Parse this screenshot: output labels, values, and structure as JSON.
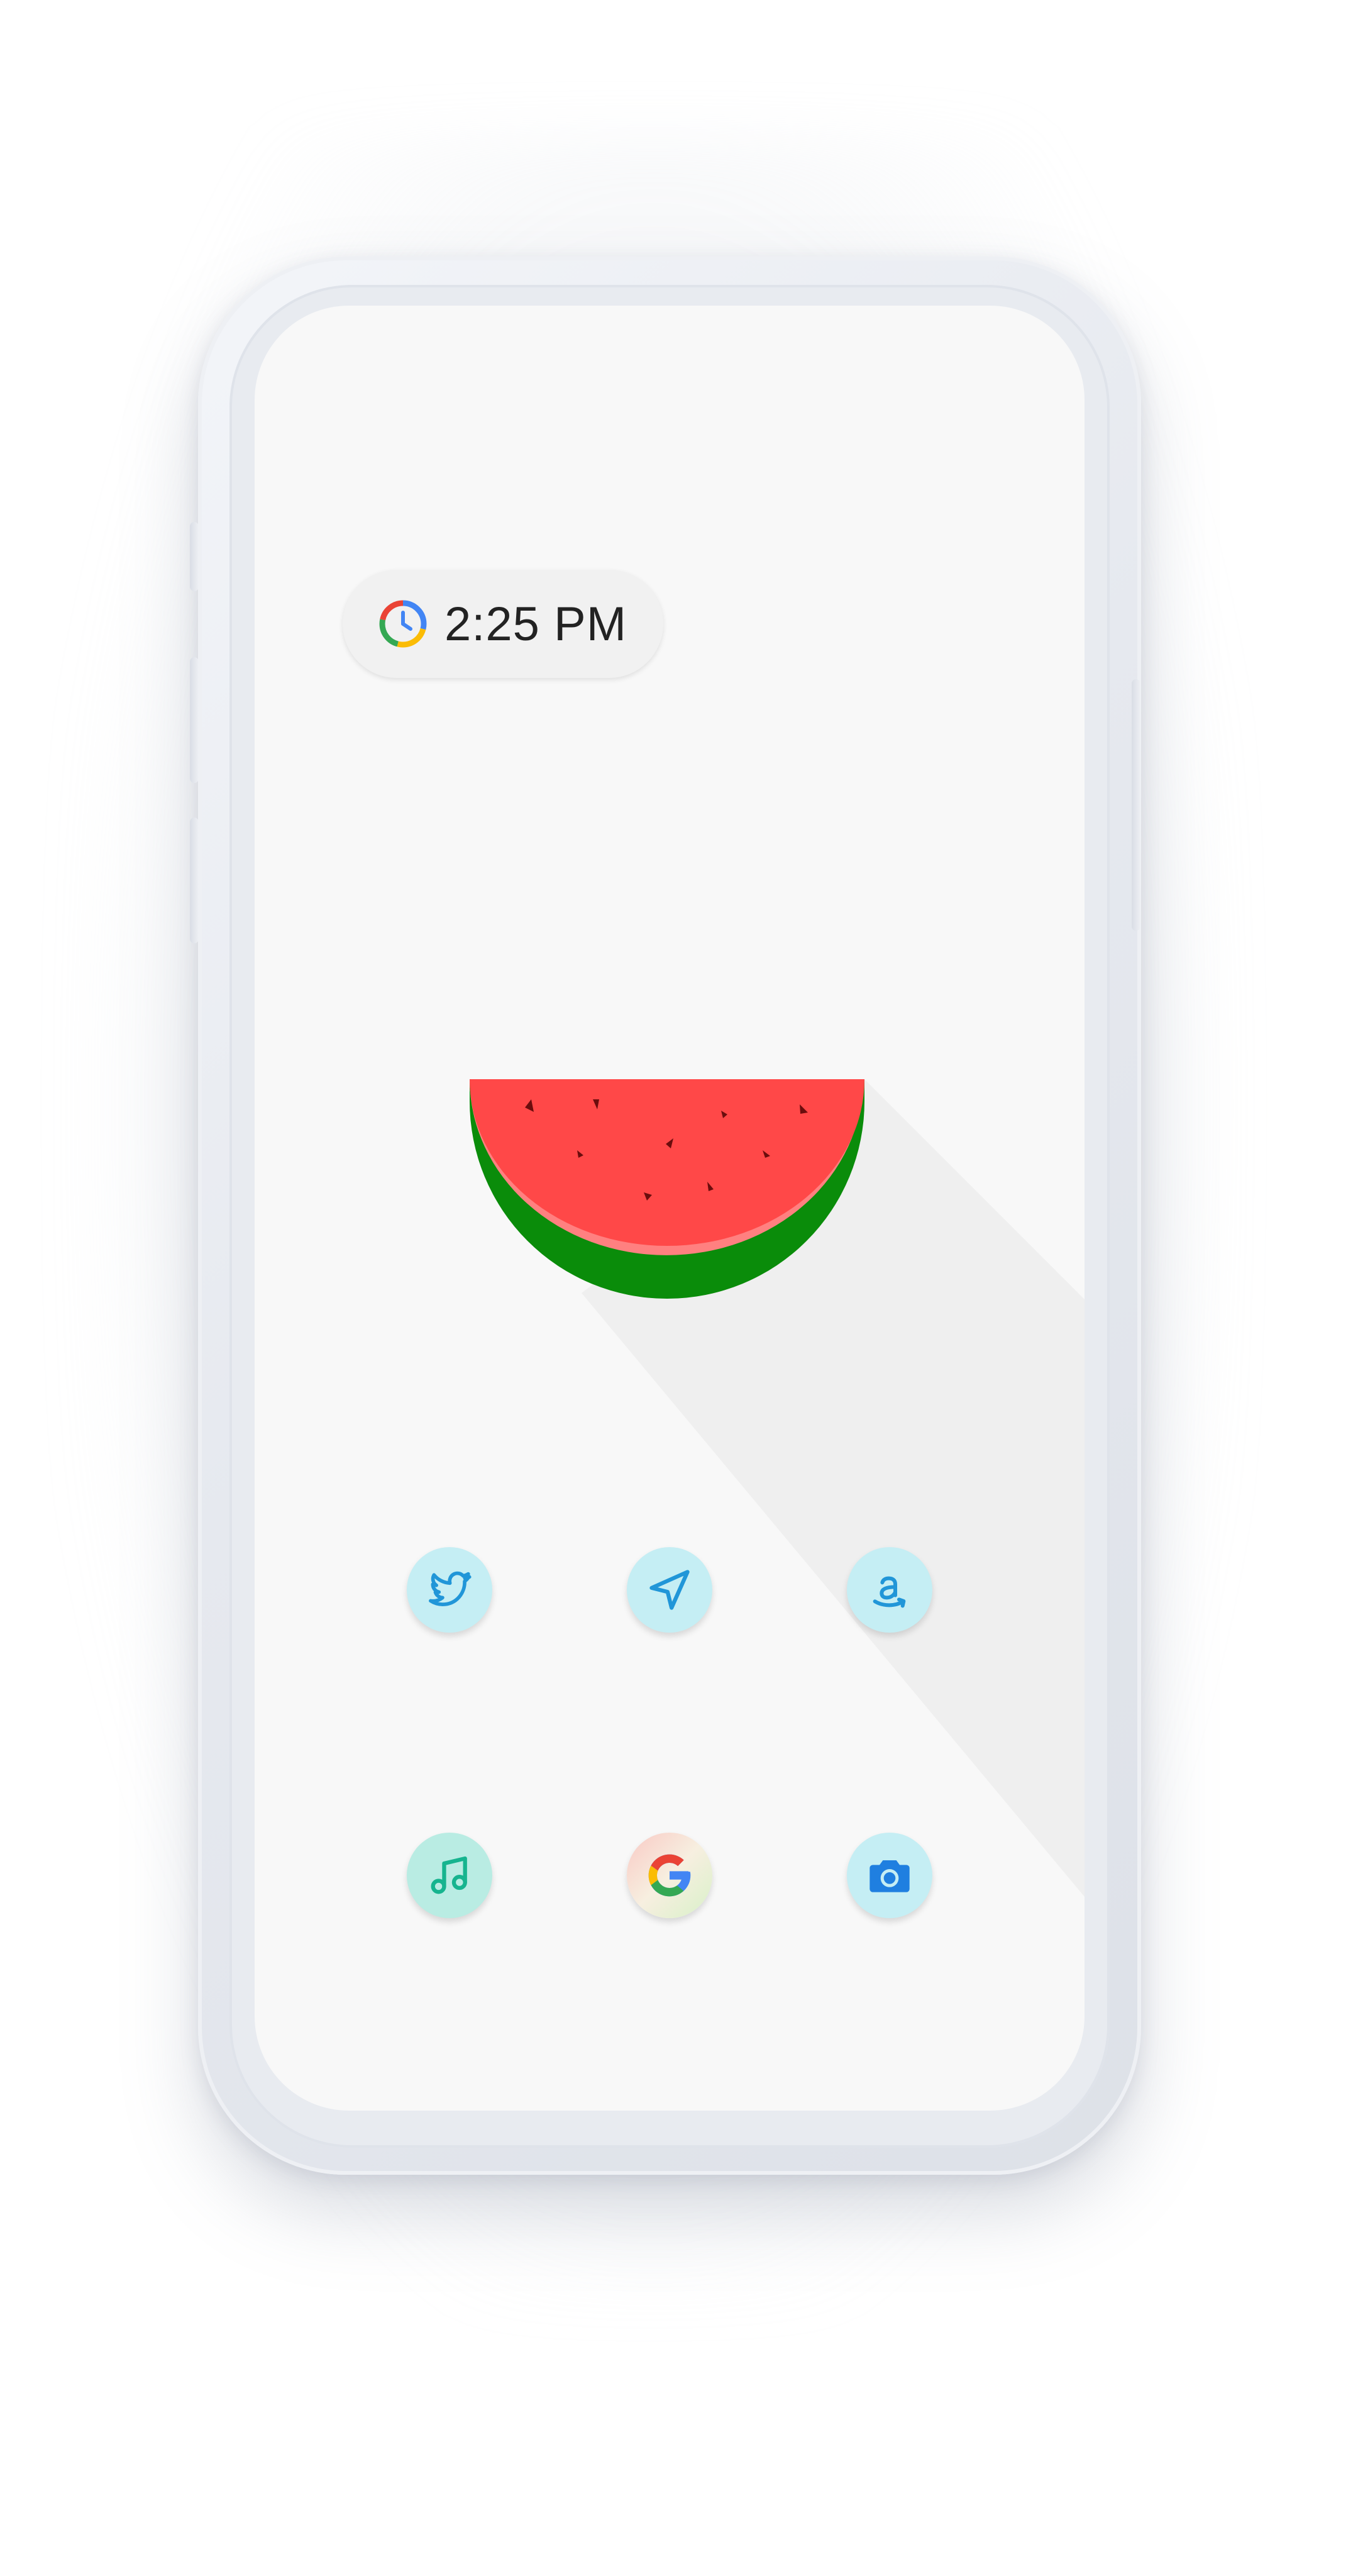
{
  "home_screen": {
    "clock_widget": {
      "time": "2:25 PM",
      "icon": "clock-icon"
    },
    "wallpaper": {
      "subject": "watermelon-slice",
      "colors": {
        "flesh": "#ff4747",
        "flesh_light": "#ff7f7f",
        "rind": "#0a8c0a",
        "seed": "#6b0d0d",
        "long_shadow": "#efefef",
        "background": "#f8f8f8"
      }
    },
    "apps": [
      {
        "icon": "twitter-bird-icon",
        "color": "#2196d8",
        "bg": "#c5eef4"
      },
      {
        "icon": "send-arrow-icon",
        "color": "#2196d8",
        "bg": "#c5eef4"
      },
      {
        "icon": "amazon-icon",
        "color": "#2196d8",
        "bg": "#c5eef4"
      },
      {
        "icon": "music-note-icon",
        "color": "#16b48f",
        "bg": "#b9ece3"
      },
      {
        "icon": "google-g-icon",
        "color": "#4285f4",
        "bg": "#f3efe1"
      },
      {
        "icon": "camera-icon",
        "color": "#1f7fe0",
        "bg": "#c5eef4"
      }
    ]
  }
}
